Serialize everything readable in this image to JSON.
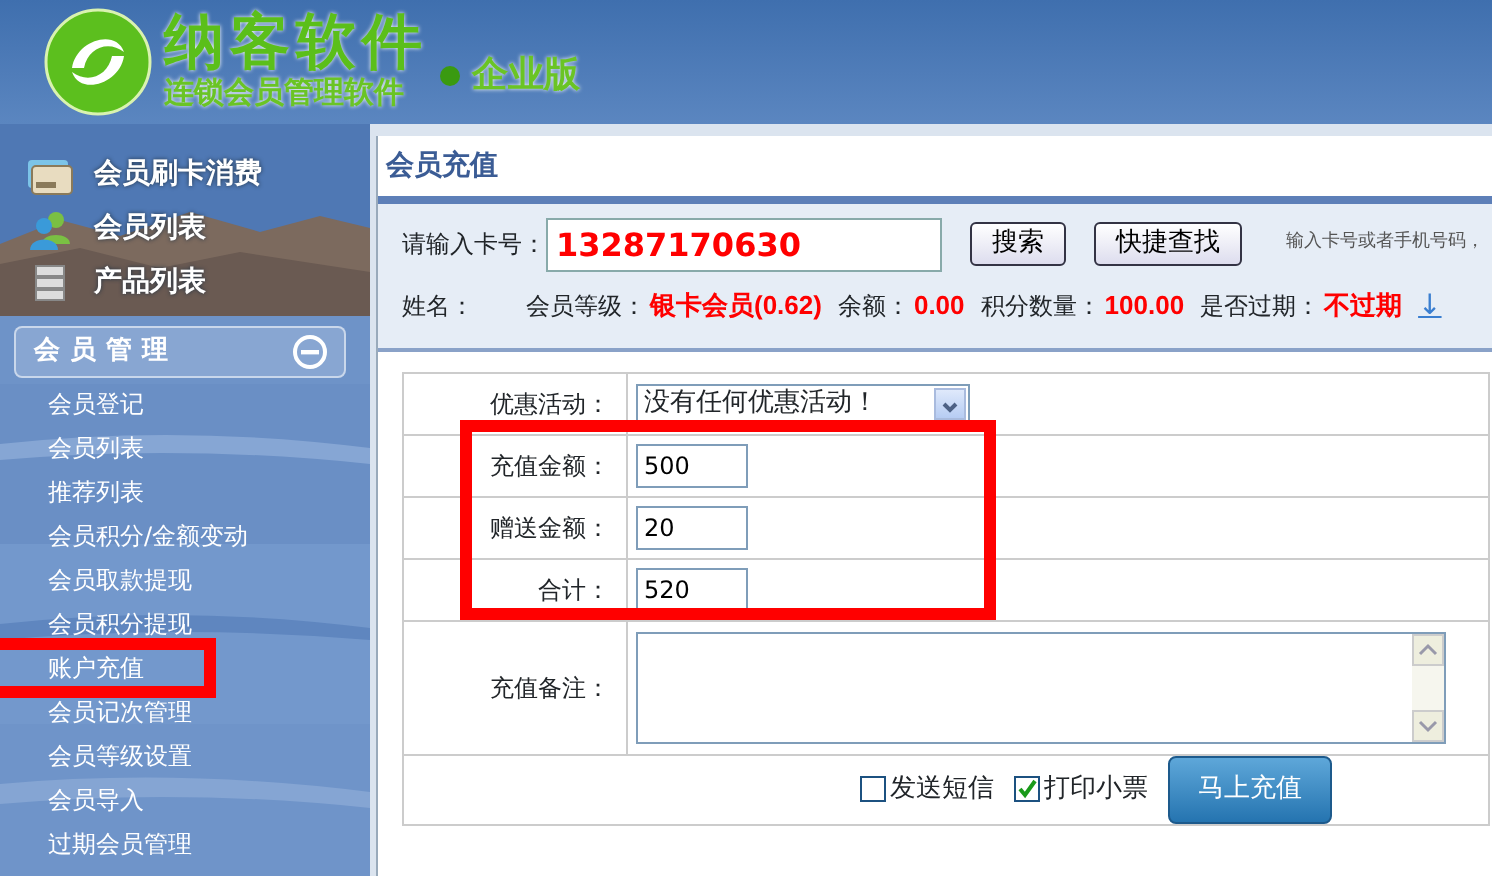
{
  "header": {
    "brand": "纳客软件",
    "edition": "企业版",
    "tagline": "连锁会员管理软件"
  },
  "sidebar": {
    "nav": [
      {
        "label": "会员刷卡消费",
        "kind": "card"
      },
      {
        "label": "会员列表",
        "kind": "people"
      },
      {
        "label": "产品列表",
        "kind": "stack"
      }
    ],
    "section": {
      "title": "会员管理",
      "expanded": true,
      "items": [
        {
          "label": "会员登记",
          "highlighted": false
        },
        {
          "label": "会员列表",
          "highlighted": false
        },
        {
          "label": "推荐列表",
          "highlighted": false
        },
        {
          "label": "会员积分/金额变动",
          "highlighted": false
        },
        {
          "label": "会员取款提现",
          "highlighted": false
        },
        {
          "label": "会员积分提现",
          "highlighted": false
        },
        {
          "label": "账户充值",
          "highlighted": true
        },
        {
          "label": "会员记次管理",
          "highlighted": false
        },
        {
          "label": "会员等级设置",
          "highlighted": false
        },
        {
          "label": "会员导入",
          "highlighted": false
        },
        {
          "label": "过期会员管理",
          "highlighted": false
        }
      ]
    }
  },
  "page": {
    "title": "会员充值",
    "lookup": {
      "label": "请输入卡号：",
      "value": "13287170630",
      "buttons": [
        "搜索",
        "快捷查找"
      ],
      "hint": "输入卡号或者手机号码，"
    },
    "member_info": [
      {
        "label": "姓名："
      },
      {
        "label": "会员等级：",
        "value": "银卡会员(0.62)"
      },
      {
        "label": "余额：",
        "value": "0.00"
      },
      {
        "label": "积分数量：",
        "value": "100.00"
      },
      {
        "label": "是否过期：",
        "value": "不过期"
      }
    ],
    "info_link": "↓",
    "form": [
      {
        "kind": "select",
        "label": "优惠活动：",
        "value": "没有任何优惠活动！",
        "highlighted": false
      },
      {
        "kind": "input",
        "label": "充值金额：",
        "value": "500",
        "highlighted": true
      },
      {
        "kind": "input",
        "label": "赠送金额：",
        "value": "20",
        "highlighted": true
      },
      {
        "kind": "input",
        "label": "合计：",
        "value": "520",
        "highlighted": true
      },
      {
        "kind": "textarea",
        "label": "充值备注：",
        "highlighted": false
      }
    ],
    "options": [
      {
        "label": "发送短信",
        "checked": false
      },
      {
        "label": "打印小票",
        "checked": true
      }
    ],
    "submit": "马上充值"
  }
}
